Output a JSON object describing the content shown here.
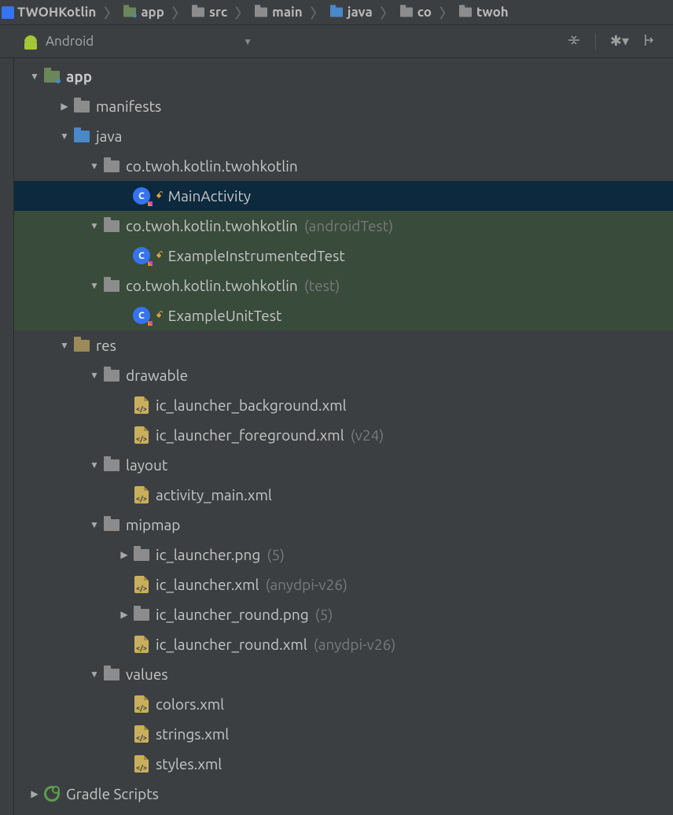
{
  "breadcrumbs": [
    {
      "label": "TWOHKotlin",
      "icon": "project"
    },
    {
      "label": "app",
      "icon": "module"
    },
    {
      "label": "src",
      "icon": "folder"
    },
    {
      "label": "main",
      "icon": "folder"
    },
    {
      "label": "java",
      "icon": "src"
    },
    {
      "label": "co",
      "icon": "folder"
    },
    {
      "label": "twoh",
      "icon": "folder"
    }
  ],
  "toolbar": {
    "viewLabel": "Android"
  },
  "tree": [
    {
      "depth": 0,
      "chev": "down",
      "icon": "module-dot",
      "label": "app",
      "bold": true
    },
    {
      "depth": 1,
      "chev": "right",
      "icon": "folder",
      "label": "manifests"
    },
    {
      "depth": 1,
      "chev": "down",
      "icon": "src",
      "label": "java"
    },
    {
      "depth": 2,
      "chev": "down",
      "icon": "folder",
      "label": "co.twoh.kotlin.twohkotlin"
    },
    {
      "depth": 3,
      "chev": "",
      "icon": "kotlin",
      "label": "MainActivity",
      "selected": true,
      "lock": true
    },
    {
      "depth": 2,
      "chev": "down",
      "icon": "folder",
      "label": "co.twoh.kotlin.twohkotlin",
      "suffix": "(androidTest)",
      "test": true
    },
    {
      "depth": 3,
      "chev": "",
      "icon": "kotlin",
      "label": "ExampleInstrumentedTest",
      "test": true,
      "lock": true
    },
    {
      "depth": 2,
      "chev": "down",
      "icon": "folder",
      "label": "co.twoh.kotlin.twohkotlin",
      "suffix": "(test)",
      "test": true
    },
    {
      "depth": 3,
      "chev": "",
      "icon": "kotlin",
      "label": "ExampleUnitTest",
      "test": true,
      "lock": true
    },
    {
      "depth": 1,
      "chev": "down",
      "icon": "res",
      "label": "res"
    },
    {
      "depth": 2,
      "chev": "down",
      "icon": "folder",
      "label": "drawable"
    },
    {
      "depth": 3,
      "chev": "",
      "icon": "xml",
      "label": "ic_launcher_background.xml"
    },
    {
      "depth": 3,
      "chev": "",
      "icon": "xml",
      "label": "ic_launcher_foreground.xml",
      "suffix": "(v24)"
    },
    {
      "depth": 2,
      "chev": "down",
      "icon": "folder",
      "label": "layout"
    },
    {
      "depth": 3,
      "chev": "",
      "icon": "xml",
      "label": "activity_main.xml"
    },
    {
      "depth": 2,
      "chev": "down",
      "icon": "folder",
      "label": "mipmap"
    },
    {
      "depth": 3,
      "chev": "right",
      "icon": "folder",
      "label": "ic_launcher.png",
      "suffix": "(5)"
    },
    {
      "depth": 3,
      "chev": "",
      "icon": "xml",
      "label": "ic_launcher.xml",
      "suffix": "(anydpi-v26)"
    },
    {
      "depth": 3,
      "chev": "right",
      "icon": "folder",
      "label": "ic_launcher_round.png",
      "suffix": "(5)"
    },
    {
      "depth": 3,
      "chev": "",
      "icon": "xml",
      "label": "ic_launcher_round.xml",
      "suffix": "(anydpi-v26)"
    },
    {
      "depth": 2,
      "chev": "down",
      "icon": "folder",
      "label": "values"
    },
    {
      "depth": 3,
      "chev": "",
      "icon": "xml",
      "label": "colors.xml"
    },
    {
      "depth": 3,
      "chev": "",
      "icon": "xml",
      "label": "strings.xml"
    },
    {
      "depth": 3,
      "chev": "",
      "icon": "xml",
      "label": "styles.xml"
    },
    {
      "depth": 0,
      "chev": "right",
      "icon": "gradle",
      "label": "Gradle Scripts"
    }
  ]
}
